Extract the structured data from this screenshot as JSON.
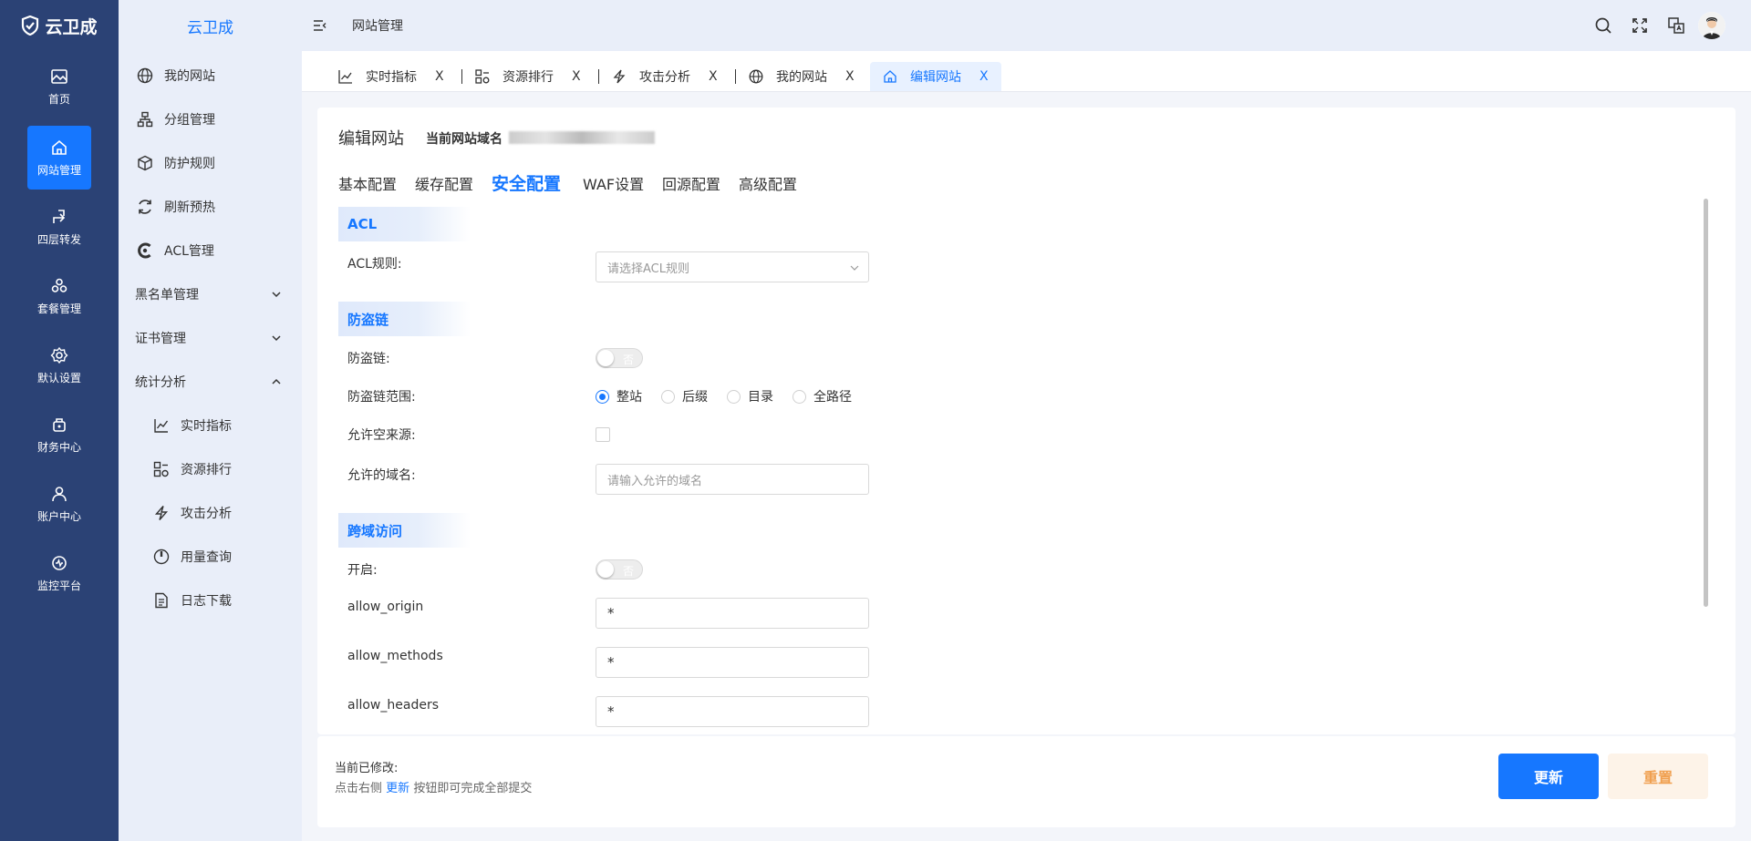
{
  "brand": {
    "name": "云卫成",
    "icon": "shield-icon"
  },
  "rail": {
    "items": [
      {
        "label": "首页",
        "icon": "image-icon"
      },
      {
        "label": "网站管理",
        "icon": "home-icon"
      },
      {
        "label": "四层转发",
        "icon": "forward-icon"
      },
      {
        "label": "套餐管理",
        "icon": "package-icon"
      },
      {
        "label": "默认设置",
        "icon": "gear-icon"
      },
      {
        "label": "财务中心",
        "icon": "wallet-icon"
      },
      {
        "label": "账户中心",
        "icon": "user-icon"
      },
      {
        "label": "监控平台",
        "icon": "monitor-icon"
      }
    ],
    "active_index": 1
  },
  "menu": {
    "title": "云卫成",
    "items": [
      {
        "label": "我的网站",
        "icon": "globe-icon"
      },
      {
        "label": "分组管理",
        "icon": "tree-icon"
      },
      {
        "label": "防护规则",
        "icon": "cube-icon"
      },
      {
        "label": "刷新预热",
        "icon": "refresh-icon"
      },
      {
        "label": "ACL管理",
        "icon": "acl-icon"
      },
      {
        "label": "黑名单管理",
        "expanded": false
      },
      {
        "label": "证书管理",
        "expanded": false
      },
      {
        "label": "统计分析",
        "expanded": true
      },
      {
        "label": "实时指标",
        "icon": "line-chart-icon"
      },
      {
        "label": "资源排行",
        "icon": "rank-icon"
      },
      {
        "label": "攻击分析",
        "icon": "lightning-icon"
      },
      {
        "label": "用量查询",
        "icon": "dial-icon"
      },
      {
        "label": "日志下载",
        "icon": "document-icon"
      }
    ]
  },
  "header": {
    "breadcrumb": "网站管理"
  },
  "tabs": [
    {
      "label": "实时指标",
      "close": "X"
    },
    {
      "label": "资源排行",
      "close": "X"
    },
    {
      "label": "攻击分析",
      "close": "X"
    },
    {
      "label": "我的网站",
      "close": "X"
    },
    {
      "label": "编辑网站",
      "close": "X"
    }
  ],
  "active_tab": 4,
  "page": {
    "title": "编辑网站",
    "domain_label": "当前网站域名",
    "subtabs": [
      "基本配置",
      "缓存配置",
      "安全配置",
      "WAF设置",
      "回源配置",
      "高级配置"
    ],
    "active_subtab": 2
  },
  "acl": {
    "section": "ACL",
    "rule_label": "ACL规则:",
    "rule_placeholder": "请选择ACL规则"
  },
  "hotlink": {
    "section": "防盗链",
    "toggle_label": "防盗链:",
    "toggle_text": "否",
    "scope_label": "防盗链范围:",
    "scope_options": [
      "整站",
      "后缀",
      "目录",
      "全路径"
    ],
    "scope_selected": 0,
    "allow_empty_label": "允许空来源:",
    "allow_empty_checked": false,
    "allowed_domains_label": "允许的域名:",
    "allowed_domains_placeholder": "请输入允许的域名"
  },
  "cors": {
    "section": "跨域访问",
    "enable_label": "开启:",
    "enable_text": "否",
    "allow_origin_label": "allow_origin",
    "allow_origin_value": "*",
    "allow_methods_label": "allow_methods",
    "allow_methods_value": "*",
    "allow_headers_label": "allow_headers",
    "allow_headers_value": "*"
  },
  "footer": {
    "line1": "当前已修改:",
    "line2_prefix": "点击右侧",
    "line2_highlight": "更新",
    "line2_suffix": "按钮即可完成全部提交",
    "update_button": "更新",
    "reset_button": "重置"
  },
  "colors": {
    "rail_bg": "#2b4275",
    "accent": "#1677ff",
    "menu_bg": "#e9eef9",
    "reset_text": "#f0a050"
  }
}
